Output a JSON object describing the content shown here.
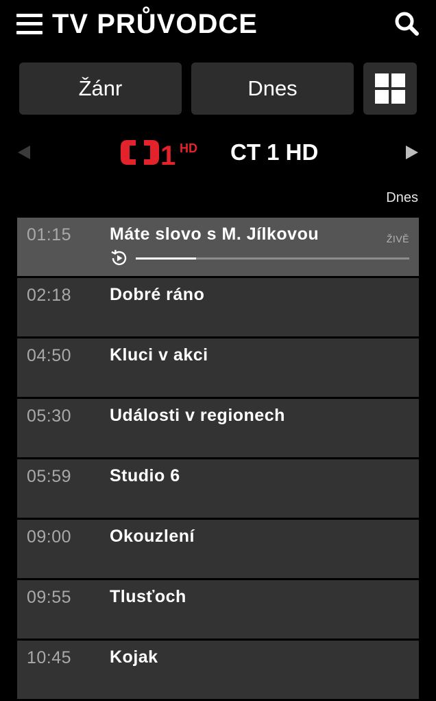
{
  "header": {
    "title": "TV PRŮVODCE",
    "menu_icon": "hamburger-menu-icon",
    "search_icon": "search-icon"
  },
  "filters": {
    "genre_label": "Žánr",
    "day_label": "Dnes",
    "grid_icon": "grid-view-icon"
  },
  "channel": {
    "logo_number": "1",
    "logo_suffix": "HD",
    "name": "CT 1 HD",
    "logo_color": "#e4222b",
    "prev_icon": "arrow-left-icon",
    "next_icon": "arrow-right-icon"
  },
  "date_label": "Dnes",
  "programmes": [
    {
      "time": "01:15",
      "title": "Máte slovo s M. Jílkovou",
      "live_label": "ŽIVĚ",
      "progress": 0.22
    },
    {
      "time": "02:18",
      "title": "Dobré ráno"
    },
    {
      "time": "04:50",
      "title": "Kluci v akci"
    },
    {
      "time": "05:30",
      "title": "Události v regionech"
    },
    {
      "time": "05:59",
      "title": "Studio 6"
    },
    {
      "time": "09:00",
      "title": "Okouzlení"
    },
    {
      "time": "09:55",
      "title": "Tlusťoch"
    },
    {
      "time": "10:45",
      "title": "Kojak"
    }
  ],
  "colors": {
    "background": "#000000",
    "button": "#2d2d2d",
    "row": "#333333",
    "row_current": "#555555",
    "time_text": "#a9a9a9"
  }
}
